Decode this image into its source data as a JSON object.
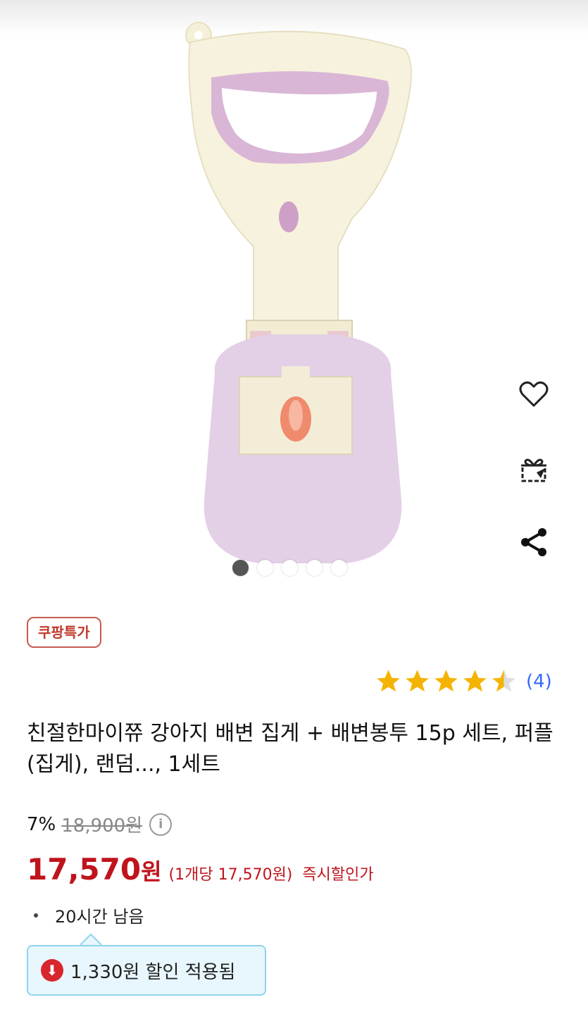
{
  "product": {
    "image_alt": "pink and cream pet poop scooper",
    "carousel": {
      "count": 5,
      "active_index": 0
    },
    "badge": "쿠팡특가",
    "rating": {
      "stars": 4.5,
      "review_count": "(4)"
    },
    "title": "친절한마이쮸 강아지 배변 집게 + 배변봉투 15p 세트, 퍼플(집게), 랜덤..., 1세트",
    "discount_rate": "7%",
    "original_price": "18,900원",
    "sale_price": "17,570",
    "sale_currency": "원",
    "unit_price": "(1개당 17,570원)",
    "instant_label": "즉시할인가",
    "time_left": "20시간 남음",
    "coupon_text": "1,330원 할인 적용됨"
  },
  "actions": {
    "like": "heart-icon",
    "gift": "gift-icon",
    "share": "share-icon"
  },
  "colors": {
    "accent_red": "#c0141c",
    "star": "#f5b301",
    "link_blue": "#346aff",
    "coupon_bg": "#e8f7fd"
  }
}
